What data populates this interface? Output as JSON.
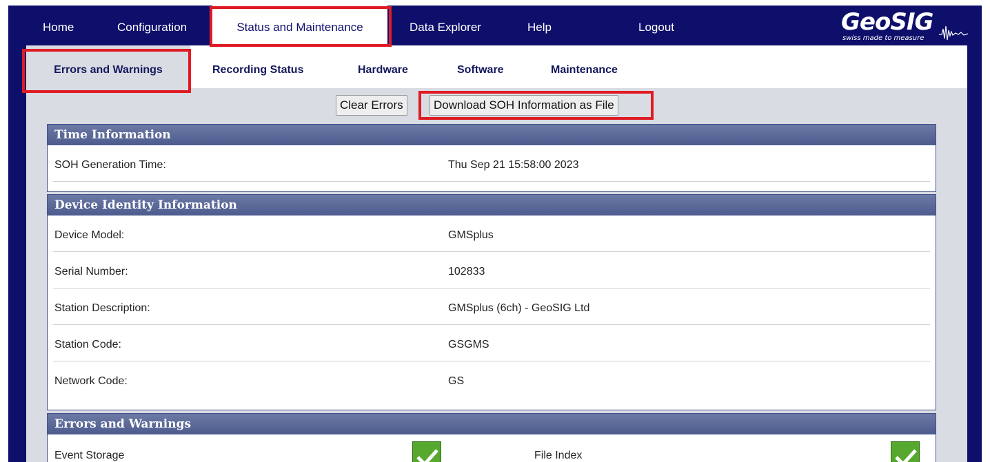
{
  "topnav": {
    "items": [
      {
        "label": "Home"
      },
      {
        "label": "Configuration"
      },
      {
        "label": "Status and Maintenance"
      },
      {
        "label": "Data Explorer"
      },
      {
        "label": "Help"
      },
      {
        "label": "Logout"
      }
    ],
    "active_index": 2
  },
  "logo": {
    "text": "GeoSIG",
    "tagline": "swiss made to measure"
  },
  "subnav": {
    "items": [
      {
        "label": "Errors and Warnings"
      },
      {
        "label": "Recording Status"
      },
      {
        "label": "Hardware"
      },
      {
        "label": "Software"
      },
      {
        "label": "Maintenance"
      }
    ],
    "active_index": 0
  },
  "actions": {
    "clear_errors": "Clear Errors",
    "download_soh": "Download SOH Information as File"
  },
  "time_info": {
    "title": "Time Information",
    "rows": [
      {
        "label": "SOH Generation Time:",
        "value": "Thu Sep 21 15:58:00 2023"
      }
    ]
  },
  "device_identity": {
    "title": "Device Identity Information",
    "rows": [
      {
        "label": "Device Model:",
        "value": "GMSplus"
      },
      {
        "label": "Serial Number:",
        "value": "102833"
      },
      {
        "label": "Station Description:",
        "value": "GMSplus (6ch) - GeoSIG Ltd"
      },
      {
        "label": "Station Code:",
        "value": "GSGMS"
      },
      {
        "label": "Network Code:",
        "value": "GS"
      }
    ]
  },
  "errors_warnings": {
    "title": "Errors and Warnings",
    "items": [
      {
        "label": "Event Storage",
        "status": "ok"
      },
      {
        "label": "File Index",
        "status": "ok"
      }
    ]
  },
  "colors": {
    "nav_background": "#0e0f6b",
    "panel_background": "#d9dce3",
    "section_header": "#4c5b8e",
    "ok_check": "#56a82e",
    "highlight": "#e01b24"
  }
}
